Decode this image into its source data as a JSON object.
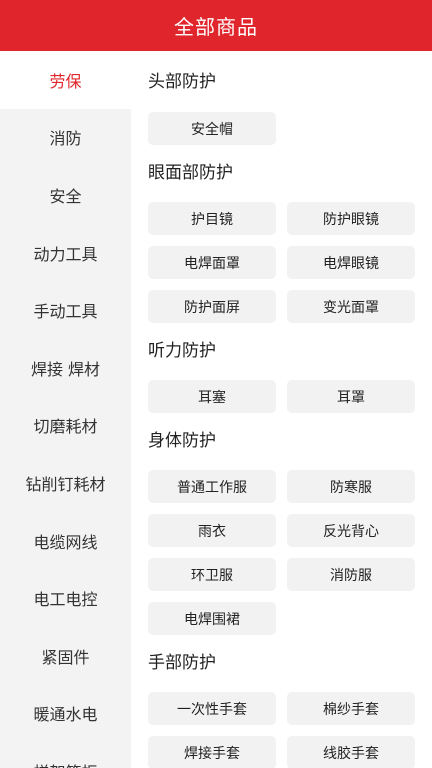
{
  "header": {
    "title": "全部商品"
  },
  "sidebar": {
    "items": [
      {
        "label": "劳保",
        "active": true
      },
      {
        "label": "消防"
      },
      {
        "label": "安全"
      },
      {
        "label": "动力工具"
      },
      {
        "label": "手动工具"
      },
      {
        "label": "焊接 焊材"
      },
      {
        "label": "切磨耗材"
      },
      {
        "label": "钻削钉耗材"
      },
      {
        "label": "电缆网线"
      },
      {
        "label": "电工电控"
      },
      {
        "label": "紧固件"
      },
      {
        "label": "暖通水电"
      },
      {
        "label": "梯架箱柜"
      }
    ]
  },
  "content": {
    "sections": [
      {
        "title": "头部防护",
        "items": [
          "安全帽"
        ]
      },
      {
        "title": "眼面部防护",
        "items": [
          "护目镜",
          "防护眼镜",
          "电焊面罩",
          "电焊眼镜",
          "防护面屏",
          "变光面罩"
        ]
      },
      {
        "title": "听力防护",
        "items": [
          "耳塞",
          "耳罩"
        ]
      },
      {
        "title": "身体防护",
        "items": [
          "普通工作服",
          "防寒服",
          "雨衣",
          "反光背心",
          "环卫服",
          "消防服",
          "电焊围裙"
        ]
      },
      {
        "title": "手部防护",
        "items": [
          "一次性手套",
          "棉纱手套",
          "焊接手套",
          "线胶手套"
        ]
      }
    ]
  },
  "colors": {
    "accent": "#e0262c",
    "sidebar_bg": "#f3f3f3",
    "chip_bg": "#f2f2f2"
  }
}
